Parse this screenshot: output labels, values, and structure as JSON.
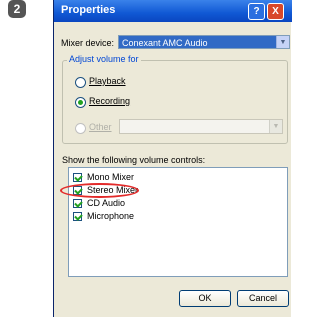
{
  "step_number": "2",
  "window": {
    "title": "Properties",
    "help_glyph": "?",
    "close_glyph": "X"
  },
  "mixer_device": {
    "label": "Mixer device:",
    "value": "Conexant AMC Audio"
  },
  "adjust_volume": {
    "legend": "Adjust volume for",
    "options": [
      {
        "label": "Playback",
        "selected": false,
        "enabled": true
      },
      {
        "label": "Recording",
        "selected": true,
        "enabled": true
      },
      {
        "label": "Other",
        "selected": false,
        "enabled": false
      }
    ]
  },
  "volume_controls": {
    "label": "Show the following volume controls:",
    "items": [
      {
        "label": "Mono Mixer",
        "checked": true
      },
      {
        "label": "Stereo Mixer",
        "checked": true
      },
      {
        "label": "CD Audio",
        "checked": true
      },
      {
        "label": "Microphone",
        "checked": true
      }
    ]
  },
  "buttons": {
    "ok": "OK",
    "cancel": "Cancel"
  },
  "colors": {
    "titlebar": "#1058d4",
    "dialog_bg": "#ece9d8",
    "highlight": "#e32a2a",
    "check": "#21a121"
  }
}
